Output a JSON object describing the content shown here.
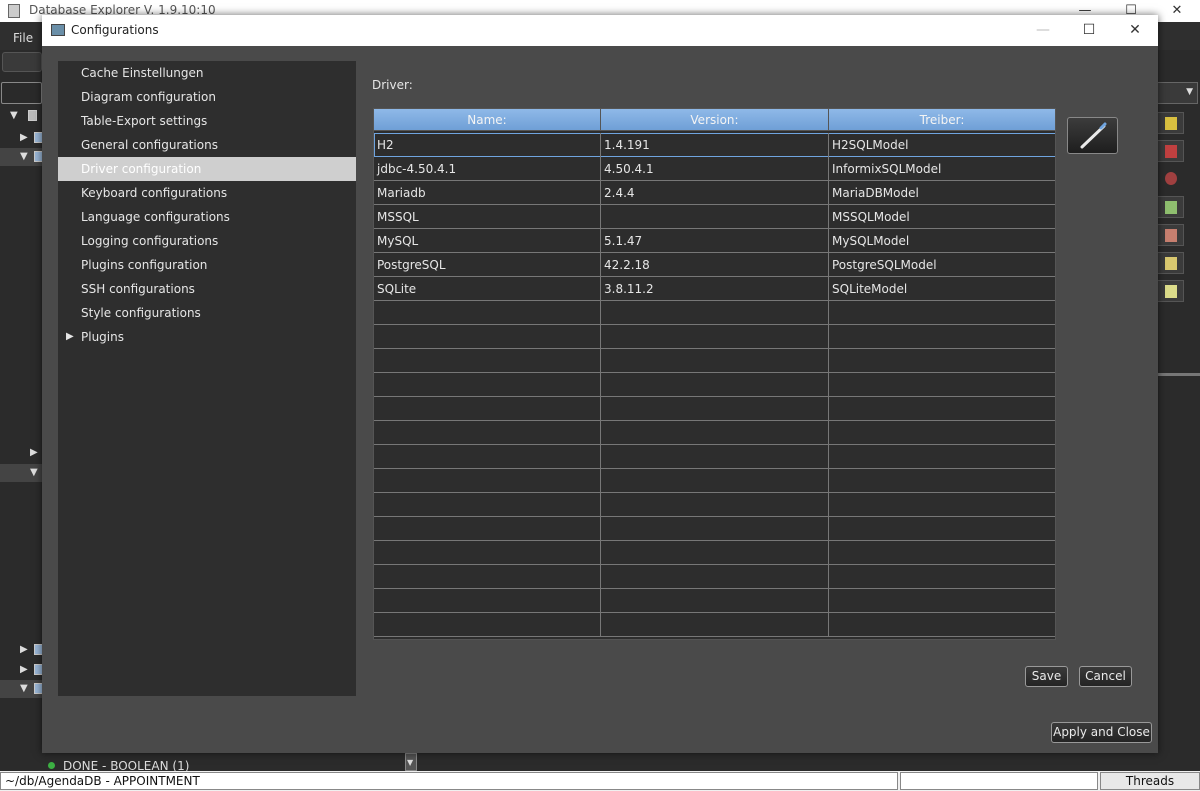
{
  "main_window": {
    "title": "Database Explorer V. 1.9.10:10",
    "minimize": "—",
    "maximize": "☐",
    "close": "✕",
    "menu": {
      "file": "File"
    },
    "bottom_row_text": "DONE - BOOLEAN (1)",
    "status": {
      "path": "~/db/AgendaDB - APPOINTMENT",
      "threads": "Threads"
    }
  },
  "dialog": {
    "title": "Configurations",
    "minimize": "—",
    "maximize": "☐",
    "close": "✕",
    "nav": [
      {
        "label": "Cache Einstellungen"
      },
      {
        "label": "Diagram configuration"
      },
      {
        "label": "Table-Export settings"
      },
      {
        "label": "General configurations"
      },
      {
        "label": "Driver configuration",
        "selected": true
      },
      {
        "label": "Keyboard configurations"
      },
      {
        "label": "Language configurations"
      },
      {
        "label": "Logging configurations"
      },
      {
        "label": "Plugins configuration"
      },
      {
        "label": "SSH configurations"
      },
      {
        "label": "Style configurations"
      },
      {
        "label": "Plugins",
        "expandable": true
      }
    ],
    "content": {
      "label": "Driver:",
      "table": {
        "columns": [
          "Name:",
          "Version:",
          "Treiber:"
        ],
        "rows": [
          [
            "H2",
            "1.4.191",
            "H2SQLModel"
          ],
          [
            "jdbc-4.50.4.1",
            "4.50.4.1",
            "InformixSQLModel"
          ],
          [
            "Mariadb",
            "2.4.4",
            "MariaDBModel"
          ],
          [
            "MSSQL",
            "",
            "MSSQLModel"
          ],
          [
            "MySQL",
            "5.1.47",
            "MySQLModel"
          ],
          [
            "PostgreSQL",
            "42.2.18",
            "PostgreSQLModel"
          ],
          [
            "SQLite",
            "3.8.11.2",
            "SQLiteModel"
          ]
        ],
        "selected_row": 0
      }
    },
    "buttons": {
      "save": "Save",
      "cancel": "Cancel",
      "apply_close": "Apply and Close"
    }
  }
}
